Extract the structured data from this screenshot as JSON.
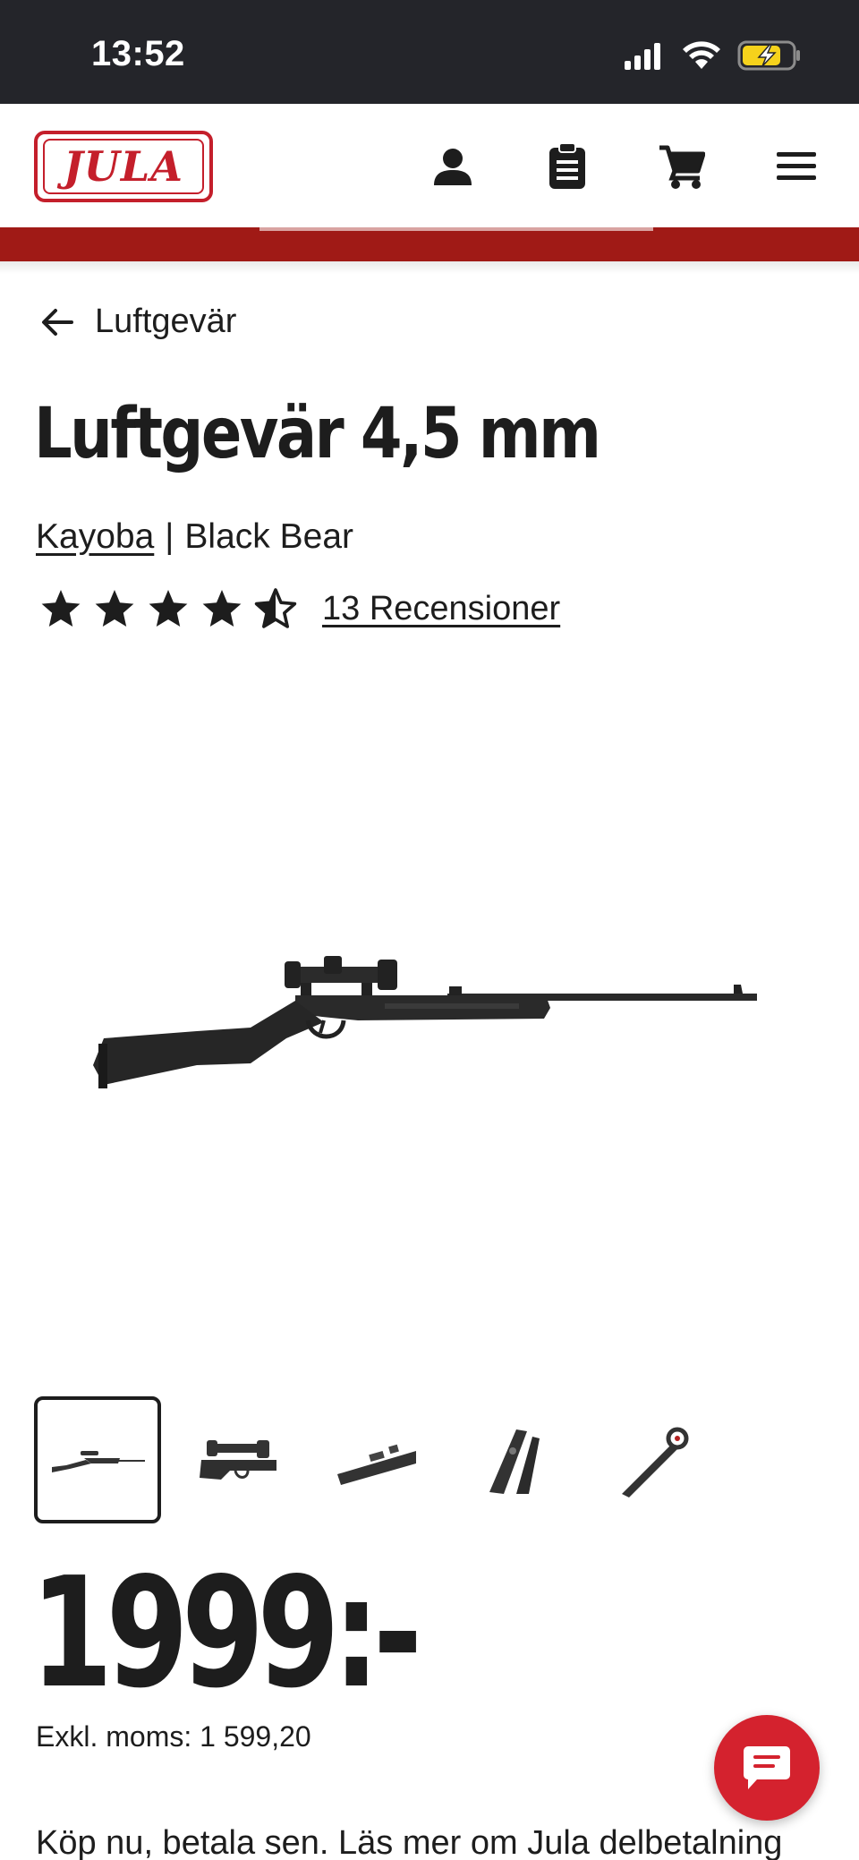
{
  "status_bar": {
    "time": "13:52",
    "battery_color": "#f5d21c"
  },
  "header": {
    "logo_text": "JULA",
    "icons": [
      "account-icon",
      "shopping-list-icon",
      "cart-icon",
      "menu-icon"
    ],
    "brand_color": "#c41f2b"
  },
  "breadcrumb": {
    "label": "Luftgevär"
  },
  "product": {
    "title": "Luftgevär 4,5 mm",
    "brand": "Kayoba",
    "separator": "|",
    "model": "Black Bear",
    "rating_value": 4.5,
    "rating_max": 5,
    "reviews_label": "13 Recensioner",
    "thumbnail_count": 5,
    "price": "1999:-",
    "vat_line": "Exkl. moms: 1 599,20",
    "installment_text": "Köp nu, betala sen. Läs mer om Jula delbetalning"
  }
}
